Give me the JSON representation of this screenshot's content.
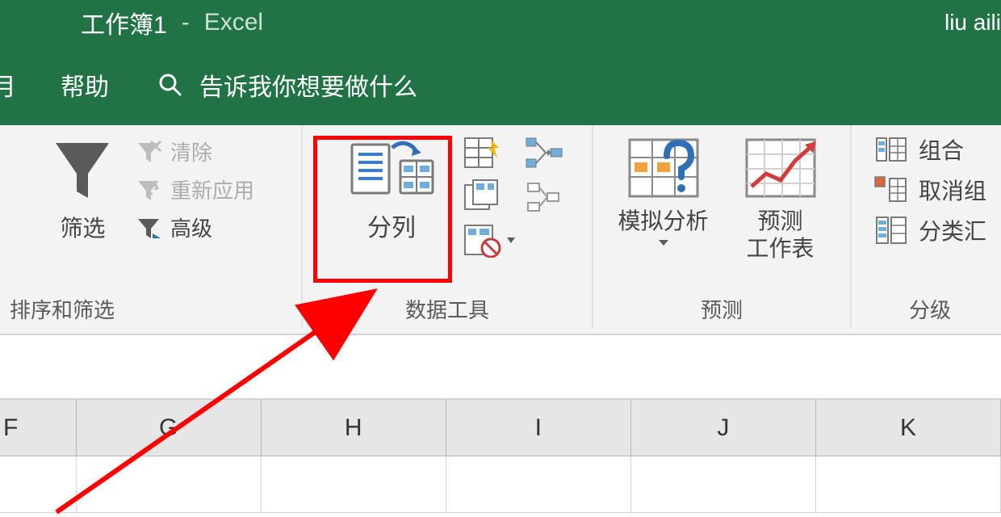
{
  "titlebar": {
    "workbook": "工作簿1",
    "dash": "-",
    "app": "Excel",
    "user": "liu aili"
  },
  "menubar": {
    "item_partial": "月",
    "help": "帮助",
    "tellme": "告诉我你想要做什么"
  },
  "ribbon": {
    "sort_filter": {
      "group_label": "排序和筛选",
      "filter": "筛选",
      "clear": "清除",
      "reapply": "重新应用",
      "advanced": "高级"
    },
    "data_tools": {
      "group_label": "数据工具",
      "text_to_columns": "分列"
    },
    "forecast": {
      "group_label": "预测",
      "whatif": "模拟分析",
      "sheet_line1": "预测",
      "sheet_line2": "工作表"
    },
    "outline": {
      "group_label": "分级",
      "group": "组合",
      "ungroup_partial": "取消组",
      "subtotal_partial": "分类汇"
    }
  },
  "columns": {
    "f": "F",
    "g": "G",
    "h": "H",
    "i": "I",
    "j": "J",
    "k": "K"
  }
}
